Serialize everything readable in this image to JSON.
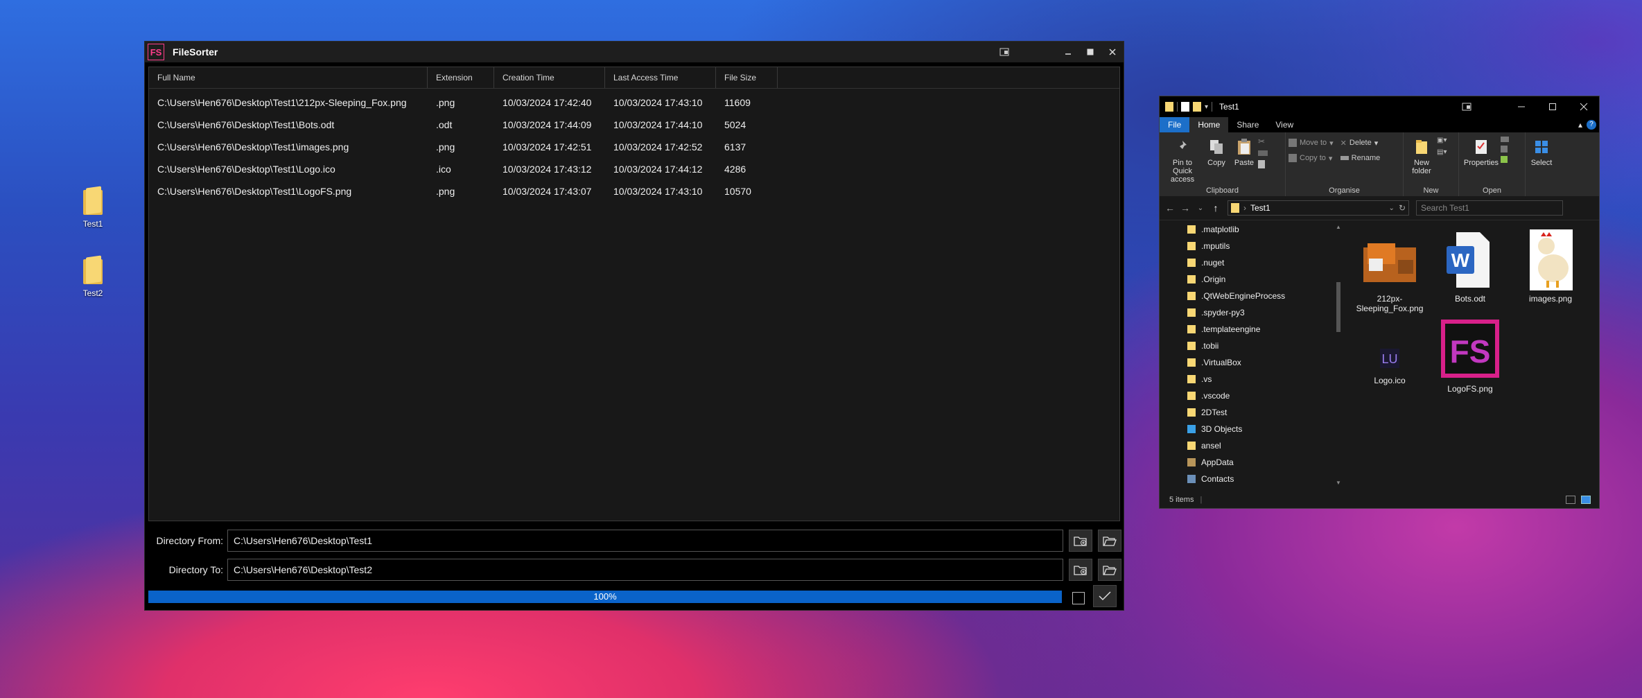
{
  "desktop": {
    "icons": [
      {
        "label": "Test1"
      },
      {
        "label": "Test2"
      }
    ]
  },
  "filesorter": {
    "app_logo": "FS",
    "title": "FileSorter",
    "columns": [
      "Full Name",
      "Extension",
      "Creation Time",
      "Last Access Time",
      "File Size"
    ],
    "rows": [
      [
        "C:\\Users\\Hen676\\Desktop\\Test1\\212px-Sleeping_Fox.png",
        ".png",
        "10/03/2024 17:42:40",
        "10/03/2024 17:43:10",
        "11609"
      ],
      [
        "C:\\Users\\Hen676\\Desktop\\Test1\\Bots.odt",
        ".odt",
        "10/03/2024 17:44:09",
        "10/03/2024 17:44:10",
        "5024"
      ],
      [
        "C:\\Users\\Hen676\\Desktop\\Test1\\images.png",
        ".png",
        "10/03/2024 17:42:51",
        "10/03/2024 17:42:52",
        "6137"
      ],
      [
        "C:\\Users\\Hen676\\Desktop\\Test1\\Logo.ico",
        ".ico",
        "10/03/2024 17:43:12",
        "10/03/2024 17:44:12",
        "4286"
      ],
      [
        "C:\\Users\\Hen676\\Desktop\\Test1\\LogoFS.png",
        ".png",
        "10/03/2024 17:43:07",
        "10/03/2024 17:43:10",
        "10570"
      ]
    ],
    "directory_from_label": "Directory From:",
    "directory_from_value": "C:\\Users\\Hen676\\Desktop\\Test1",
    "directory_to_label": "Directory To:",
    "directory_to_value": "C:\\Users\\Hen676\\Desktop\\Test2",
    "progress_text": "100%",
    "progress_value": 1.0
  },
  "explorer": {
    "title": "Test1",
    "tabs": [
      "File",
      "Home",
      "Share",
      "View"
    ],
    "ribbon": {
      "pin_label": "Pin to Quick access",
      "copy_label": "Copy",
      "paste_label": "Paste",
      "clipboard_label": "Clipboard",
      "move_to_label": "Move to",
      "copy_to_label": "Copy to",
      "delete_label": "Delete",
      "rename_label": "Rename",
      "organise_label": "Organise",
      "new_folder_label": "New folder",
      "new_label": "New",
      "properties_label": "Properties",
      "open_label": "Open",
      "select_label": "Select"
    },
    "address_crumb": "Test1",
    "search_placeholder": "Search Test1",
    "nav_items": [
      ".matplotlib",
      ".mputils",
      ".nuget",
      ".Origin",
      ".QtWebEngineProcess",
      ".spyder-py3",
      ".templateengine",
      ".tobii",
      ".VirtualBox",
      ".vs",
      ".vscode",
      "2DTest",
      "3D Objects",
      "ansel",
      "AppData",
      "Contacts"
    ],
    "files": [
      {
        "name": "212px-Sleeping_Fox.png"
      },
      {
        "name": "Bots.odt"
      },
      {
        "name": "images.png"
      },
      {
        "name": "Logo.ico"
      },
      {
        "name": "LogoFS.png"
      }
    ],
    "status_items": "5 items"
  },
  "colors": {
    "accent_blue": "#0a63c9",
    "brand_pink": "#ff3d8a",
    "folder_yellow": "#f8d774"
  }
}
